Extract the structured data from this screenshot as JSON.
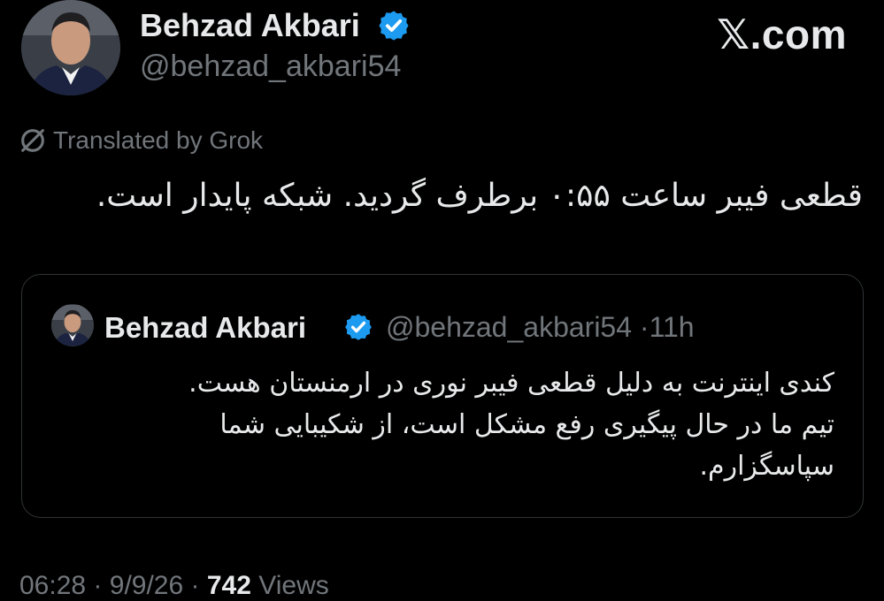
{
  "brand": {
    "site_label": "com",
    "x_glyph": "𝕏"
  },
  "author": {
    "name": "Behzad Akbari",
    "handle": "@behzad_akbari54",
    "verified": true
  },
  "translation_note": "Translated by Grok",
  "tweet": {
    "text": "قطعی فیبر ساعت ۰:۵۵ برطرف گردید. شبکه پایدار است."
  },
  "quoted_tweet": {
    "name": "Behzad Akbari",
    "handle": "@behzad_akbari54",
    "separator": "·",
    "time": "11h",
    "text_lines": [
      "کندی اینترنت به دلیل قطعی فیبر نوری در ارمنستان هست.",
      "تیم ما در حال پیگیری رفع مشکل است، از شکیبایی شما",
      "سپاسگزارم."
    ]
  },
  "meta": {
    "time": "06:28",
    "date": "9/9/26",
    "separator": "·",
    "views_count": "742",
    "views_label": "Views"
  },
  "colors": {
    "background": "#000000",
    "text": "#e7e9ea",
    "secondary": "#71767b",
    "verified": "#1d9bf0",
    "border": "#2f3336"
  },
  "icons": [
    "verified-badge-icon",
    "grok-slash-icon",
    "x-logo-icon"
  ]
}
